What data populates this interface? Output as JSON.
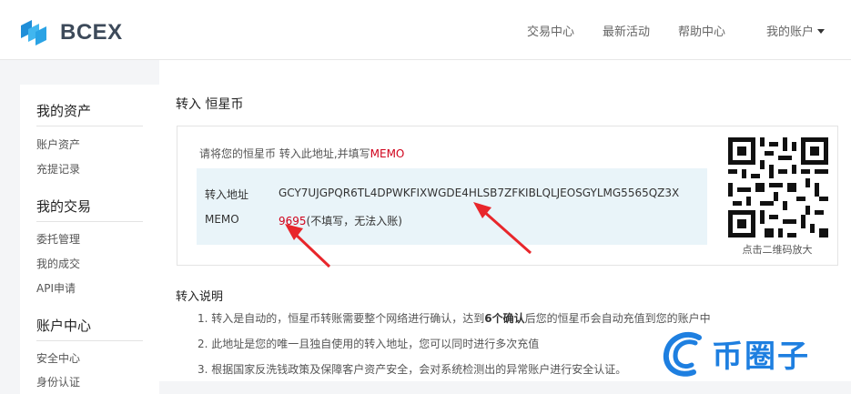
{
  "header": {
    "logo_text": "BCEX",
    "nav": [
      "交易中心",
      "最新活动",
      "帮助中心",
      "我的账户"
    ]
  },
  "sidebar": {
    "sections": [
      {
        "title": "我的资产",
        "items": [
          "账户资产",
          "充提记录"
        ]
      },
      {
        "title": "我的交易",
        "items": [
          "委托管理",
          "我的成交",
          "API申请"
        ]
      },
      {
        "title": "账户中心",
        "items": [
          "安全中心",
          "身份认证"
        ]
      }
    ]
  },
  "main": {
    "title": "转入 恒星币",
    "hint_prefix": "请将您的恒星币 转入此地址,并填写",
    "hint_memo": "MEMO",
    "address_label": "转入地址",
    "address_value": "GCY7UJGPQR6TL4DPWKFIXWGDE4HLSB7ZFKIBLQLJEOSGYLMG5565QZ3X",
    "memo_label": "MEMO",
    "memo_value": "9695",
    "memo_note": "(不填写，无法入账)",
    "qr_caption": "点击二维码放大",
    "instructions_title": "转入说明",
    "instructions": [
      {
        "pre": "1. 转入是自动的，恒星币转账需要整个网络进行确认，达到",
        "bold": "6个确认",
        "post": "后您的恒星币会自动充值到您的账户中"
      },
      {
        "pre": "2. 此地址是您的唯一且独自使用的转入地址，您可以同时进行多次充值",
        "bold": "",
        "post": ""
      },
      {
        "pre": "3. 根据国家反洗钱政策及保障客户资产安全，会对系统检测出的异常账户进行安全认证。",
        "bold": "",
        "post": ""
      }
    ]
  },
  "watermark": {
    "text": "币圈子"
  },
  "colors": {
    "accent_red": "#d0021b",
    "panel_bg": "#e9f4f9",
    "watermark_blue": "#1e7fe0"
  },
  "icons": [
    "bcex-logo-icon",
    "caret-down-icon",
    "qr-code-icon",
    "annotation-arrow-icon",
    "watermark-logo-icon"
  ]
}
